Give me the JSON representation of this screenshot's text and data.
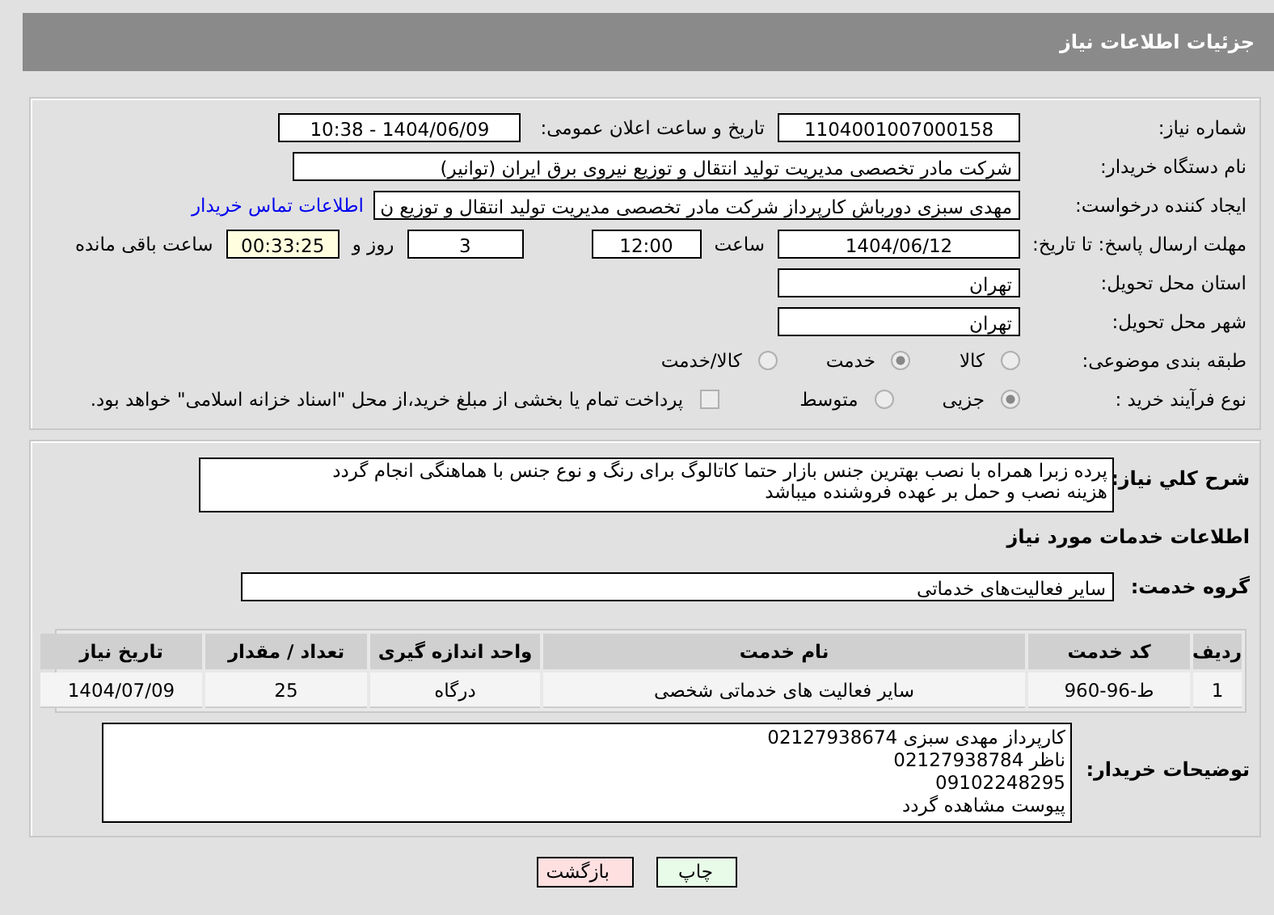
{
  "header": {
    "title": "جزئیات اطلاعات نیاز"
  },
  "info": {
    "need_number": {
      "label": "شماره نیاز:",
      "value": "1104001007000158"
    },
    "announce": {
      "label": "تاریخ و ساعت اعلان عمومی:",
      "value": "1404/06/09 - 10:38"
    },
    "buyer_org": {
      "label": "نام دستگاه خریدار:",
      "value": "شرکت مادر تخصصی مدیریت تولید  انتقال و توزیع نیروی برق ایران (توانیر)"
    },
    "creator": {
      "label": "ایجاد کننده درخواست:",
      "value": "مهدی سبزی دورباش کارپرداز شرکت مادر تخصصی مدیریت تولید  انتقال و توزیع ن",
      "link": "اطلاعات تماس خریدار"
    },
    "deadline": {
      "label": "مهلت ارسال پاسخ: تا تاریخ:",
      "date": "1404/06/12",
      "time_label": "ساعت",
      "time": "12:00",
      "days": "3",
      "days_label": "روز و",
      "remaining": "00:33:25",
      "remaining_label": "ساعت باقی مانده"
    },
    "province": {
      "label": "استان محل تحویل:",
      "value": "تهران"
    },
    "city": {
      "label": "شهر محل تحویل:",
      "value": "تهران"
    },
    "category": {
      "label": "طبقه بندی موضوعی:",
      "options": [
        {
          "label": "کالا",
          "selected": false
        },
        {
          "label": "خدمت",
          "selected": true
        },
        {
          "label": "کالا/خدمت",
          "selected": false
        }
      ]
    },
    "process": {
      "label": "نوع فرآیند خرید :",
      "options": [
        {
          "label": "جزیی",
          "selected": true
        },
        {
          "label": "متوسط",
          "selected": false
        }
      ],
      "treasury": {
        "label": "پرداخت تمام یا بخشی از مبلغ خرید،از محل \"اسناد خزانه اسلامی\" خواهد بود.",
        "checked": false
      }
    }
  },
  "details": {
    "description": {
      "label": "شرح کلي نیاز:",
      "lines": [
        "پرده زبرا همراه با نصب بهترین جنس بازار حتما کاتالوگ برای رنگ و نوع جنس با هماهنگی انجام گردد",
        "هزینه نصب و حمل بر عهده فروشنده میباشد"
      ]
    },
    "section_title": "اطلاعات خدمات مورد نیاز",
    "service_group": {
      "label": "گروه خدمت:",
      "value": "سایر فعالیت‌های خدماتی"
    },
    "table": {
      "columns": [
        "ردیف",
        "کد خدمت",
        "نام خدمت",
        "واحد اندازه گیری",
        "تعداد / مقدار",
        "تاریخ نیاز"
      ],
      "rows": [
        [
          "1",
          "ط-96-960",
          "سایر فعالیت های خدماتی شخصی",
          "درگاه",
          "25",
          "1404/07/09"
        ]
      ]
    },
    "buyer_notes": {
      "label": "توضیحات خریدار:",
      "lines": [
        "کارپرداز مهدی سبزی 02127938674",
        "ناظر 02127938784",
        "09102248295",
        "پیوست مشاهده گردد"
      ]
    }
  },
  "buttons": [
    {
      "label": "چاپ",
      "kind": "print"
    },
    {
      "label": "بازگشت",
      "kind": "back"
    }
  ]
}
